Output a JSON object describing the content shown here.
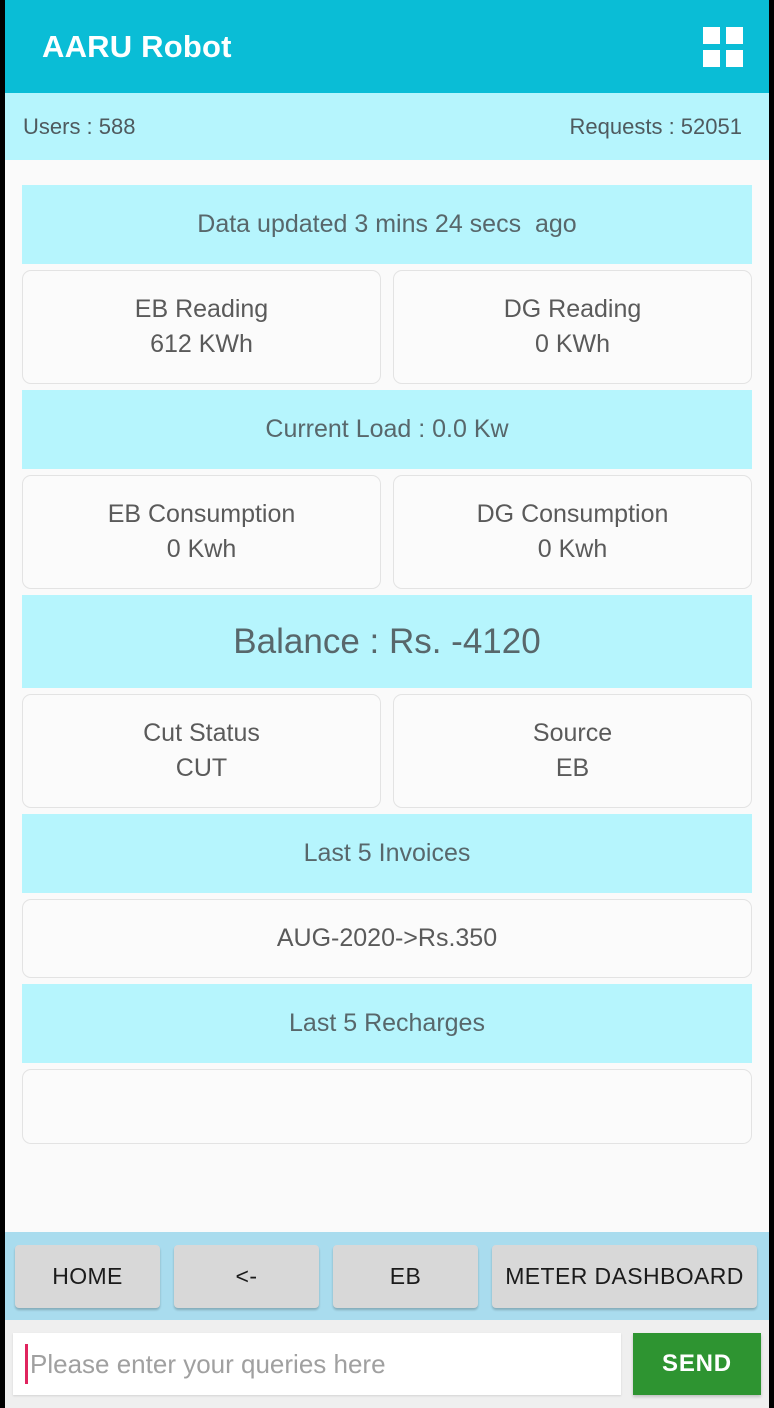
{
  "header": {
    "title": "AARU Robot",
    "menu_icon": "grid-menu-icon"
  },
  "stats": {
    "users_label": "Users : 588",
    "requests_label": "Requests : 52051"
  },
  "dashboard": {
    "updated_banner": "Data updated 3 mins 24 secs  ago",
    "reading": {
      "eb_title": "EB Reading",
      "eb_value": "612 KWh",
      "dg_title": "DG Reading",
      "dg_value": "0 KWh"
    },
    "current_load_banner": "Current Load : 0.0 Kw",
    "consumption": {
      "eb_title": "EB Consumption",
      "eb_value": "0 Kwh",
      "dg_title": "DG Consumption",
      "dg_value": "0 Kwh"
    },
    "balance_banner": "Balance : Rs. -4120",
    "status": {
      "cut_title": "Cut Status",
      "cut_value": "CUT",
      "source_title": "Source",
      "source_value": "EB"
    },
    "invoices_banner": "Last 5 Invoices",
    "invoices": [
      "AUG-2020->Rs.350"
    ],
    "recharges_banner": "Last 5 Recharges",
    "recharges": [
      ""
    ]
  },
  "quick_replies": [
    {
      "label": "HOME"
    },
    {
      "label": "<-"
    },
    {
      "label": "EB"
    },
    {
      "label": "METER DASHBOARD"
    },
    {
      "label": ""
    }
  ],
  "composer": {
    "placeholder": "Please enter your queries here",
    "value": "",
    "send_label": "SEND"
  },
  "colors": {
    "accent": "#0abdd6",
    "band": "#b6f5fd",
    "quickbar": "#a9dcee",
    "send": "#2e9431",
    "caret": "#e0245e"
  }
}
